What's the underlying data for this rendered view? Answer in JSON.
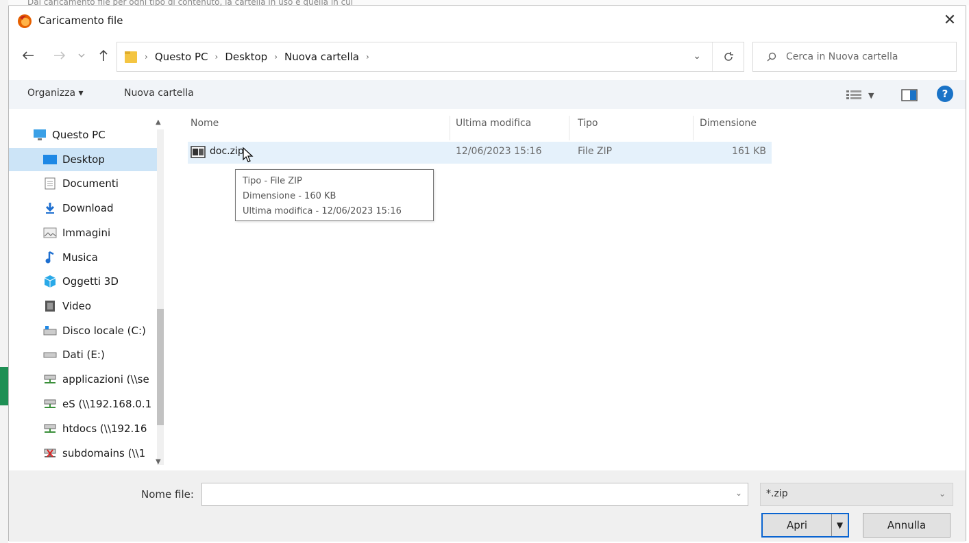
{
  "background": {
    "top_text": "Dal caricamento file per ogni tipo di contenuto, la cartella in uso è quella in cui",
    "accent": "#1e8f54"
  },
  "dialog": {
    "title": "Caricamento file",
    "close_glyph": "✕"
  },
  "address": {
    "crumbs": [
      "Questo PC",
      "Desktop",
      "Nuova cartella"
    ]
  },
  "search": {
    "placeholder": "Cerca in Nuova cartella"
  },
  "toolbar": {
    "organize_label": "Organizza ▾",
    "new_folder_label": "Nuova cartella",
    "help_glyph": "?"
  },
  "sidebar": {
    "items": [
      {
        "label": "Questo PC",
        "icon": "computer-icon"
      },
      {
        "label": "Desktop",
        "icon": "desktop-icon"
      },
      {
        "label": "Documenti",
        "icon": "documents-icon"
      },
      {
        "label": "Download",
        "icon": "download-icon"
      },
      {
        "label": "Immagini",
        "icon": "pictures-icon"
      },
      {
        "label": "Musica",
        "icon": "music-icon"
      },
      {
        "label": "Oggetti 3D",
        "icon": "objects-3d-icon"
      },
      {
        "label": "Video",
        "icon": "video-icon"
      },
      {
        "label": "Disco locale (C:)",
        "icon": "local-disk-icon"
      },
      {
        "label": "Dati (E:)",
        "icon": "drive-icon"
      },
      {
        "label": "applicazioni (\\\\se",
        "icon": "network-drive-icon"
      },
      {
        "label": "eS (\\\\192.168.0.1",
        "icon": "network-drive-icon"
      },
      {
        "label": "htdocs (\\\\192.16",
        "icon": "network-drive-icon"
      },
      {
        "label": "subdomains (\\\\1",
        "icon": "network-drive-disconnected-icon"
      }
    ]
  },
  "filelist": {
    "columns": [
      "Nome",
      "Ultima modifica",
      "Tipo",
      "Dimensione"
    ],
    "rows": [
      {
        "name": "doc.zip",
        "modified": "12/06/2023 15:16",
        "type": "File ZIP",
        "size": "161 KB"
      }
    ],
    "tooltip": {
      "line1": "Tipo - File ZIP",
      "line2": "Dimensione - 160 KB",
      "line3": "Ultima modifica - 12/06/2023 15:16"
    }
  },
  "footer": {
    "filename_label": "Nome file:",
    "filename_value": "",
    "filter_value": "*.zip",
    "open_label": "Apri",
    "cancel_label": "Annulla"
  }
}
